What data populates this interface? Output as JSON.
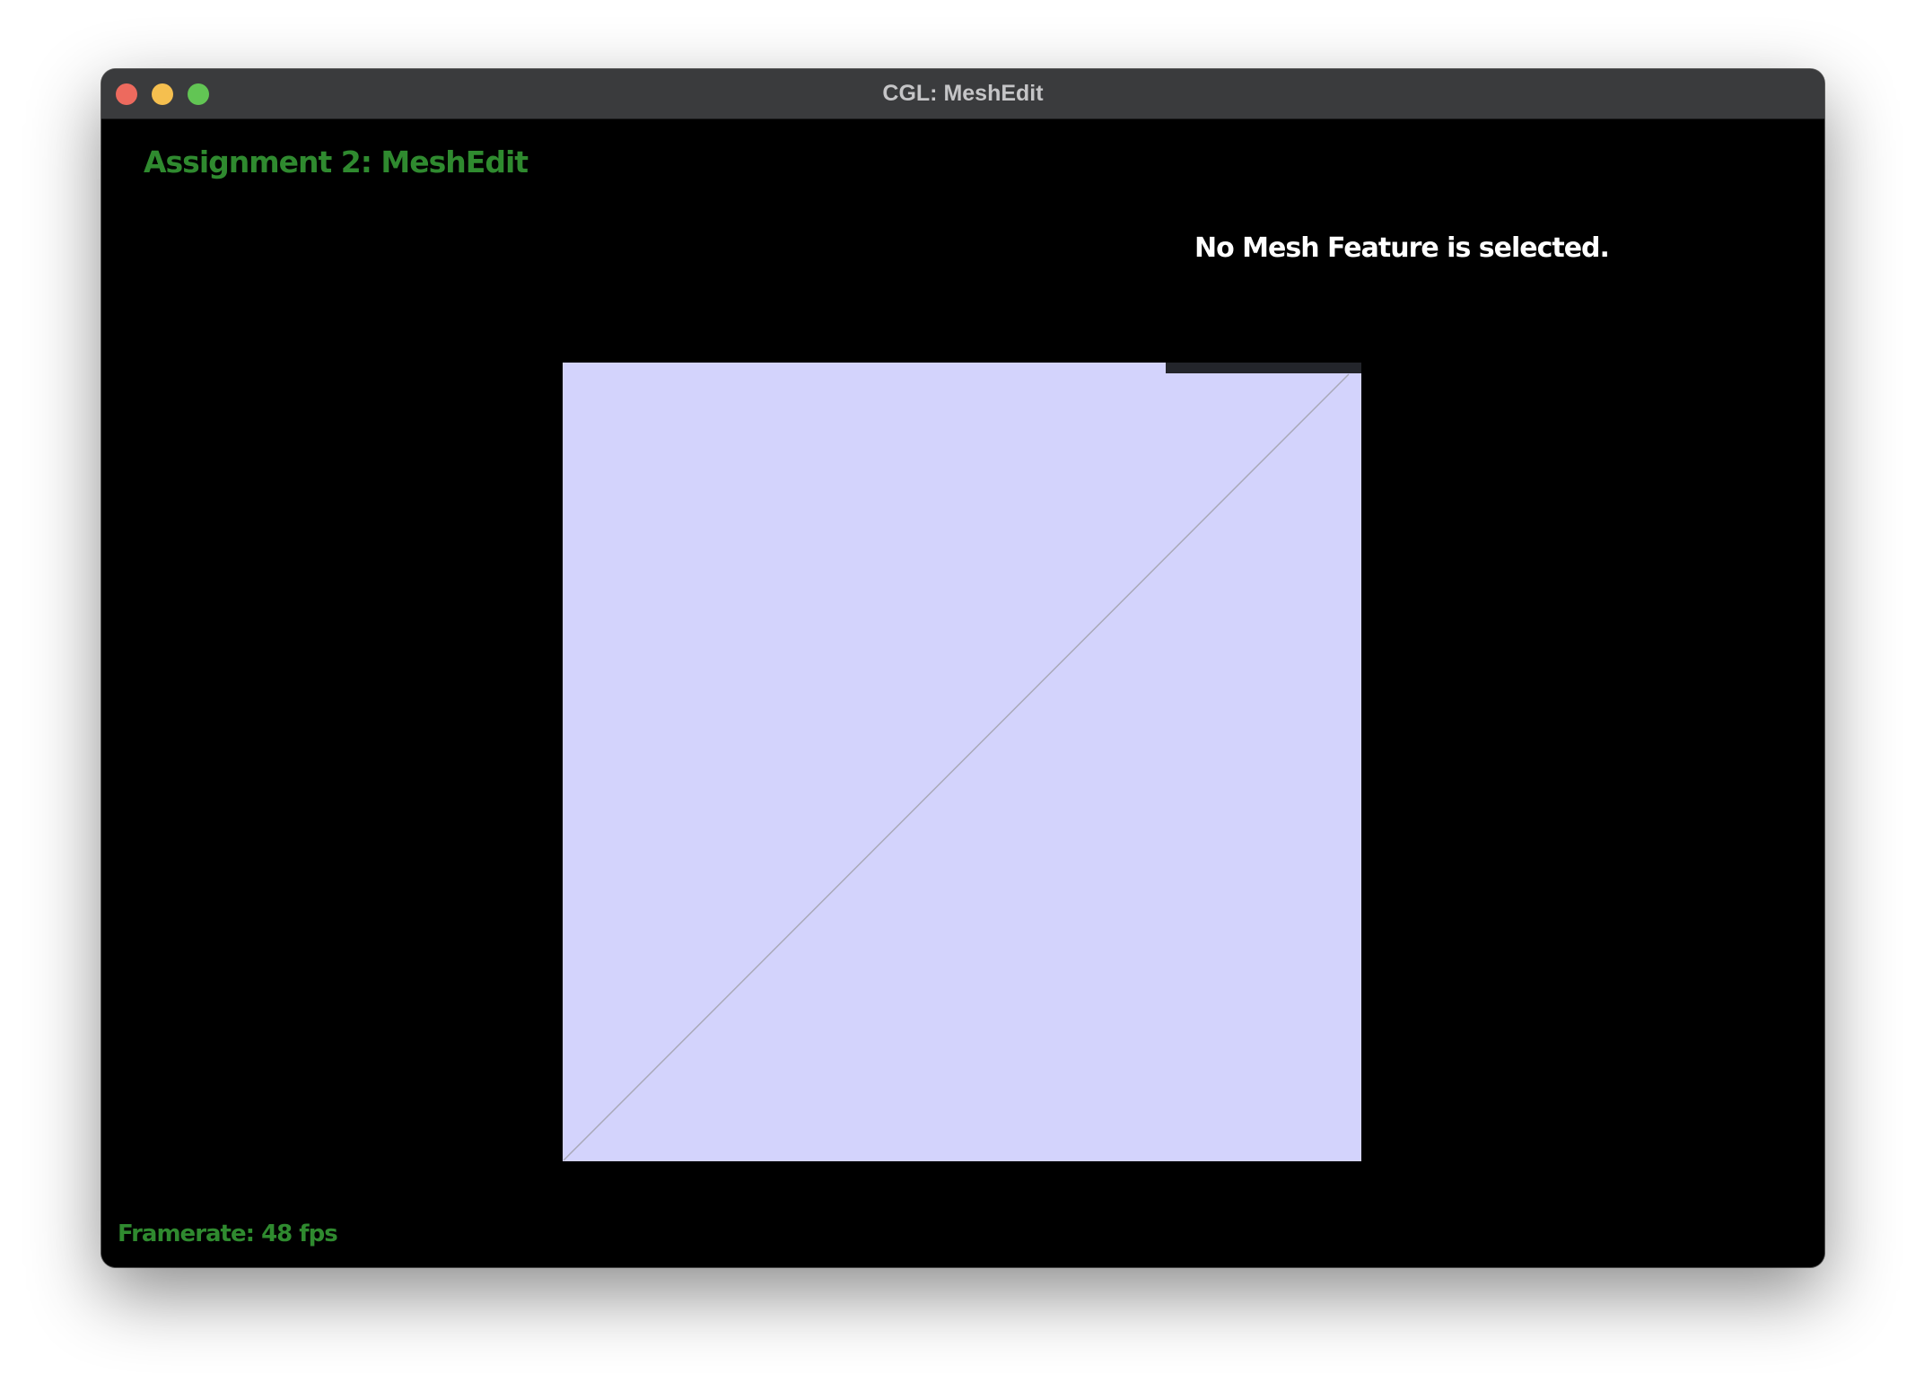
{
  "window": {
    "title": "CGL: MeshEdit",
    "controls": [
      "close",
      "minimize",
      "zoom"
    ]
  },
  "hud": {
    "heading": "Assignment 2: MeshEdit",
    "selection_info": "No Mesh Feature is selected.",
    "framerate": "Framerate: 48 fps"
  },
  "colors": {
    "background": "#000000",
    "titlebar": "#3a3b3d",
    "hud_green": "#2f8a2f",
    "mesh_face": "#d3d3fc",
    "mesh_edge": "#a9a9b8",
    "info_panel": "#23252b"
  }
}
